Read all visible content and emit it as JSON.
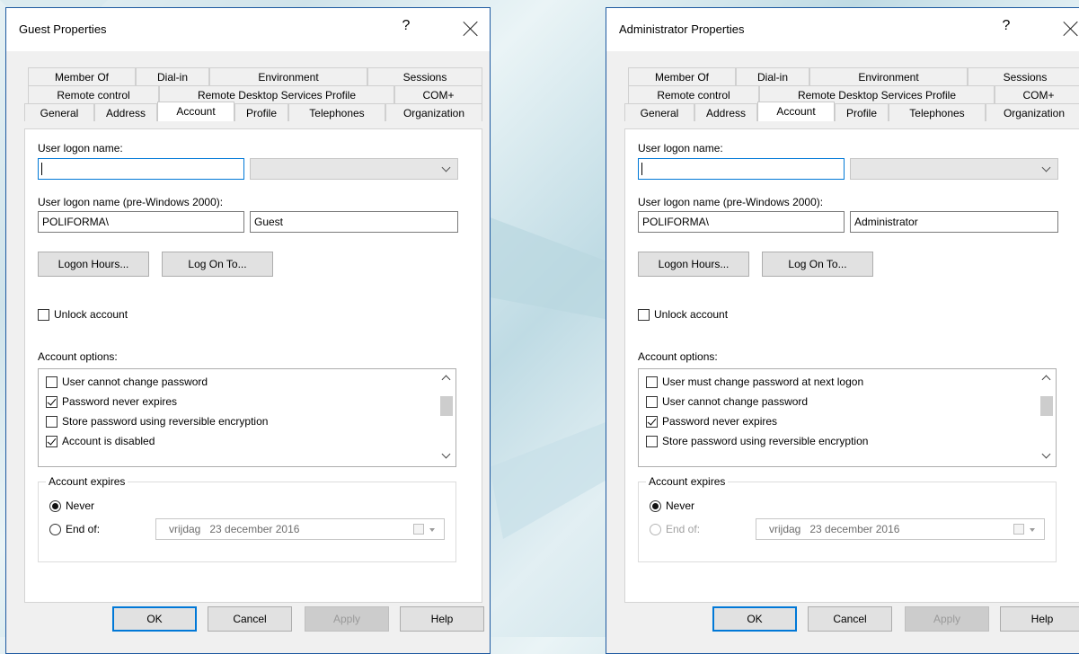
{
  "background": {
    "colors": [
      "#cfe3ea",
      "#eaf4f6",
      "#bfdbe4"
    ]
  },
  "tab_rows": [
    [
      "Member Of",
      "Dial-in",
      "Environment",
      "Sessions"
    ],
    [
      "Remote control",
      "Remote Desktop Services Profile",
      "COM+"
    ],
    [
      "General",
      "Address",
      "Account",
      "Profile",
      "Telephones",
      "Organization"
    ]
  ],
  "common": {
    "title_help": "?",
    "logon_name_label": "User logon name:",
    "pre2000_label": "User logon name (pre-Windows 2000):",
    "domain_prefix": "POLIFORMA\\",
    "logon_hours_button": "Logon Hours...",
    "log_on_to_button": "Log On To...",
    "unlock_account": "Unlock account",
    "account_options_label": "Account options:",
    "account_expires_label": "Account expires",
    "never_label": "Never",
    "end_of_label": "End of:",
    "date_day": "vrijdag",
    "date_value": "23 december 2016",
    "ok_button": "OK",
    "cancel_button": "Cancel",
    "apply_button": "Apply",
    "help_button": "Help"
  },
  "guest": {
    "title": "Guest Properties",
    "logon_name": "",
    "username": "Guest",
    "options": [
      {
        "label": "User cannot change password",
        "checked": false
      },
      {
        "label": "Password never expires",
        "checked": true
      },
      {
        "label": "Store password using reversible encryption",
        "checked": false
      },
      {
        "label": "Account is disabled",
        "checked": true
      }
    ],
    "expires": "never",
    "end_of_enabled": true
  },
  "admin": {
    "title": "Administrator Properties",
    "logon_name": "",
    "username": "Administrator",
    "options": [
      {
        "label": "User must change password at next logon",
        "checked": false
      },
      {
        "label": "User cannot change password",
        "checked": false
      },
      {
        "label": "Password never expires",
        "checked": true
      },
      {
        "label": "Store password using reversible encryption",
        "checked": false
      }
    ],
    "expires": "never",
    "end_of_enabled": false
  }
}
